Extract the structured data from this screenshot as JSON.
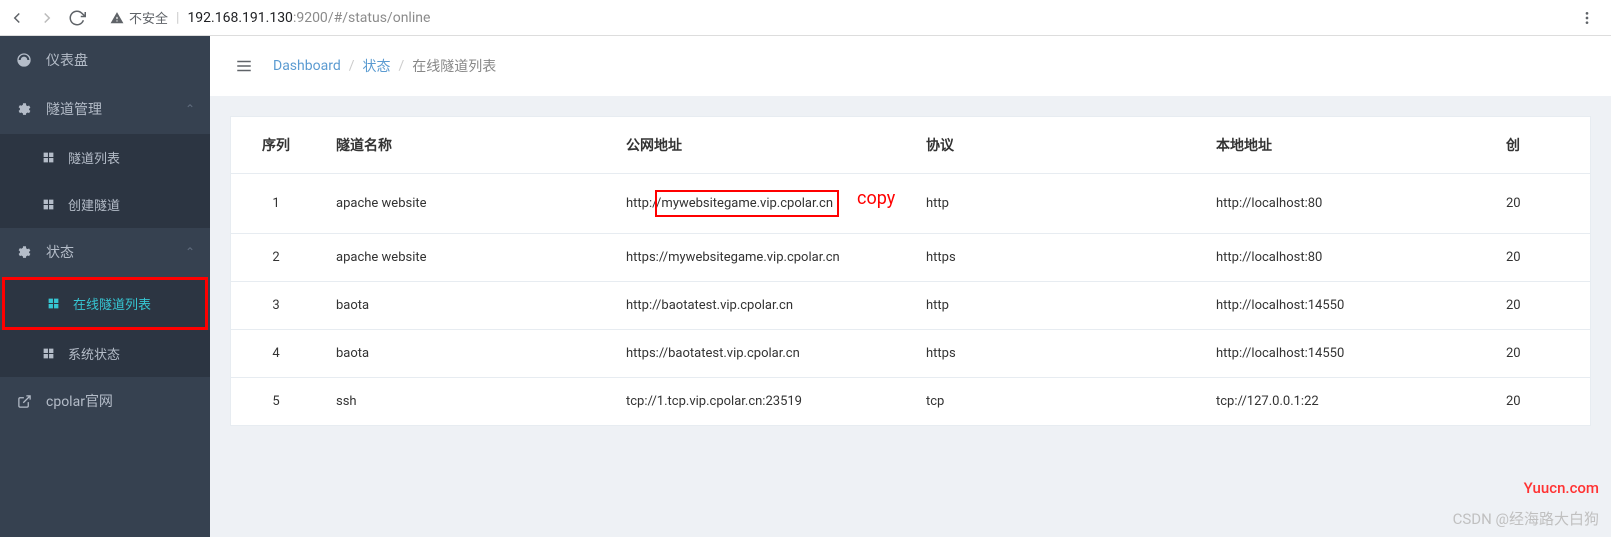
{
  "browser": {
    "insecure_label": "不安全",
    "url_host": "192.168.191.130",
    "url_port": ":9200",
    "url_path": "/#/status/online"
  },
  "sidebar": {
    "dashboard": "仪表盘",
    "tunnel_mgmt": "隧道管理",
    "tunnel_list": "隧道列表",
    "create_tunnel": "创建隧道",
    "status": "状态",
    "online_list": "在线隧道列表",
    "system_status": "系统状态",
    "official": "cpolar官网"
  },
  "breadcrumb": {
    "dashboard": "Dashboard",
    "status": "状态",
    "current": "在线隧道列表"
  },
  "table": {
    "headers": {
      "seq": "序列",
      "name": "隧道名称",
      "public_addr": "公网地址",
      "protocol": "协议",
      "local_addr": "本地地址",
      "created": "创"
    },
    "rows": [
      {
        "seq": "1",
        "name": "apache website",
        "public_prefix": "http://",
        "public_host": "mywebsitegame.vip.cpolar.cn",
        "protocol": "http",
        "local": "http://localhost:80",
        "created": "20",
        "highlight": true
      },
      {
        "seq": "2",
        "name": "apache website",
        "public_prefix": "",
        "public_host": "https://mywebsitegame.vip.cpolar.cn",
        "protocol": "https",
        "local": "http://localhost:80",
        "created": "20",
        "highlight": false
      },
      {
        "seq": "3",
        "name": "baota",
        "public_prefix": "",
        "public_host": "http://baotatest.vip.cpolar.cn",
        "protocol": "http",
        "local": "http://localhost:14550",
        "created": "20",
        "highlight": false
      },
      {
        "seq": "4",
        "name": "baota",
        "public_prefix": "",
        "public_host": "https://baotatest.vip.cpolar.cn",
        "protocol": "https",
        "local": "http://localhost:14550",
        "created": "20",
        "highlight": false
      },
      {
        "seq": "5",
        "name": "ssh",
        "public_prefix": "",
        "public_host": "tcp://1.tcp.vip.cpolar.cn:23519",
        "protocol": "tcp",
        "local": "tcp://127.0.0.1:22",
        "created": "20",
        "highlight": false
      }
    ]
  },
  "annotations": {
    "copy": "copy"
  },
  "watermark": {
    "w1": "Yuucn.com",
    "w2": "CSDN @经海路大白狗"
  }
}
